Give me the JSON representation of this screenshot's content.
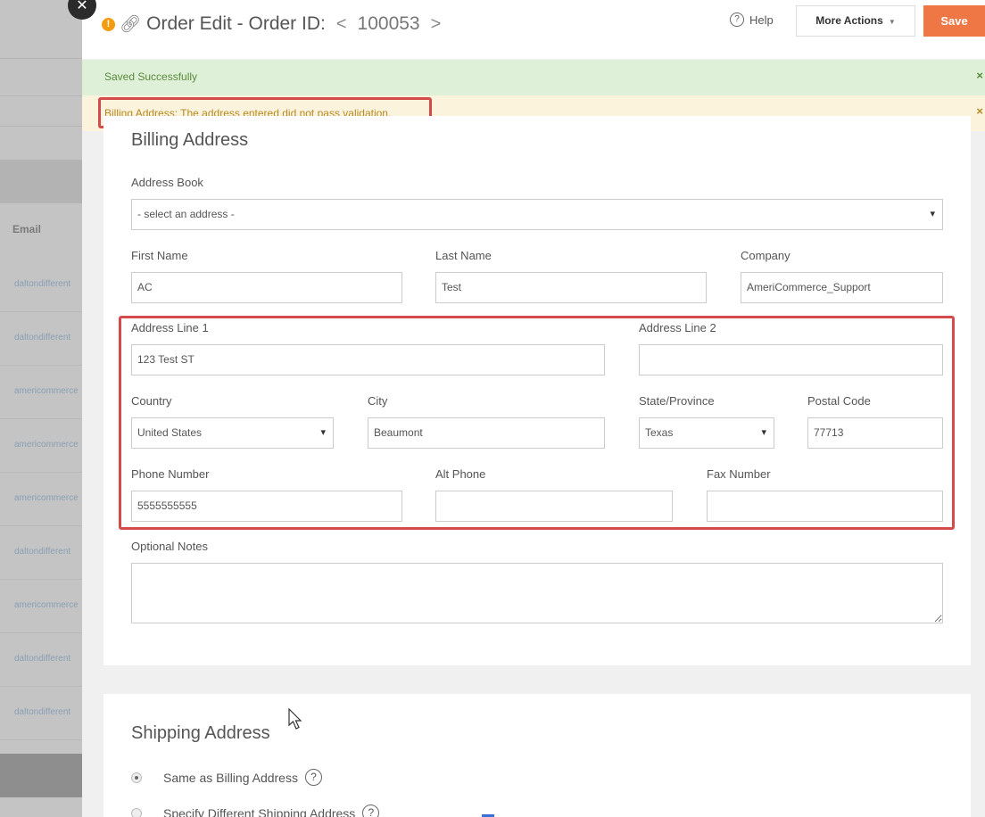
{
  "background": {
    "email_header": "Email",
    "rows": [
      "daltondifferent",
      "daltondifferent",
      "americommerce",
      "americommerce",
      "americommerce",
      "daltondifferent",
      "americommerce",
      "daltondifferent",
      "daltondifferent"
    ]
  },
  "header": {
    "title": "Order Edit - Order ID:",
    "prev_arrow": "<",
    "order_id": "100053",
    "next_arrow": ">",
    "help_label": "Help",
    "more_actions_label": "More Actions",
    "save_label": "Save"
  },
  "alerts": {
    "success": "Saved Successfully",
    "warning": "Billing Address: The address entered did not pass validation."
  },
  "billing": {
    "section_title": "Billing Address",
    "address_book_label": "Address Book",
    "address_book_value": "- select an address -",
    "first_name_label": "First Name",
    "first_name_value": "AC",
    "last_name_label": "Last Name",
    "last_name_value": "Test",
    "company_label": "Company",
    "company_value": "AmeriCommerce_Support",
    "address1_label": "Address Line 1",
    "address1_value": "123 Test ST",
    "address2_label": "Address Line 2",
    "address2_value": "",
    "country_label": "Country",
    "country_value": "United States",
    "city_label": "City",
    "city_value": "Beaumont",
    "state_label": "State/Province",
    "state_value": "Texas",
    "postal_label": "Postal Code",
    "postal_value": "77713",
    "phone_label": "Phone Number",
    "phone_value": "5555555555",
    "alt_phone_label": "Alt Phone",
    "alt_phone_value": "",
    "fax_label": "Fax Number",
    "fax_value": "",
    "notes_label": "Optional Notes"
  },
  "shipping": {
    "section_title": "Shipping Address",
    "option_same": "Same as Billing Address",
    "option_different": "Specify Different Shipping Address"
  },
  "colors": {
    "save_button": "#ef7745",
    "success_bg": "#dff0d8",
    "warning_bg": "#fcf3dc",
    "highlight": "#d44b4b"
  }
}
